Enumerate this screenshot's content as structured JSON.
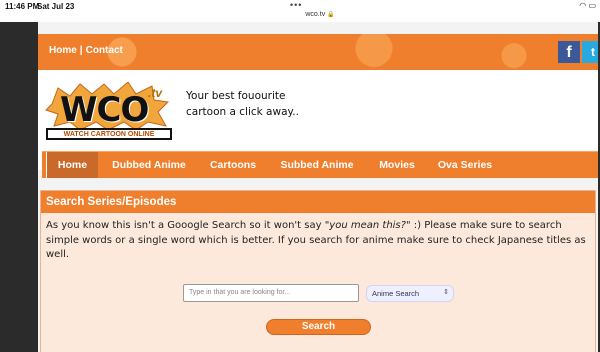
{
  "status_bar": {
    "time": "11:46 PM",
    "date": "Sat Jul 23",
    "url": "wco.tv",
    "battery_icon": "battery-icon",
    "wifi_icon": "wifi-icon"
  },
  "top_links": {
    "home": "Home",
    "separator": "|",
    "contact": "Contact"
  },
  "social": {
    "facebook": "f",
    "twitter": "t"
  },
  "logo": {
    "main": "WCO",
    "suffix": ".tv",
    "banner": "WATCH CARTOON ONLINE"
  },
  "tagline": {
    "line1": "Your best fouourite",
    "line2": "cartoon a click away.."
  },
  "nav": {
    "items": [
      {
        "label": "Home"
      },
      {
        "label": "Dubbed Anime"
      },
      {
        "label": "Cartoons"
      },
      {
        "label": "Subbed Anime"
      },
      {
        "label": "Movies"
      },
      {
        "label": "Ova Series"
      }
    ]
  },
  "search_panel": {
    "title": "Search Series/Episodes",
    "text_part1": "As you know this isn't a Gooogle Search so it won't say ",
    "text_quote": "\"you mean this?\"",
    "text_part2": " :) Please make sure to search simple words or a single word which is better. If you search for anime make sure to check Japanese titles as well.",
    "input_placeholder": "Type in that you are looking for...",
    "select_value": "Anime Search",
    "button_label": "Search"
  },
  "colors": {
    "brand_orange": "#ef7f2d",
    "nav_active": "#c96a2a",
    "panel_bg": "#fce9dc",
    "facebook_blue": "#3b5998",
    "twitter_blue": "#2aa9e0"
  }
}
